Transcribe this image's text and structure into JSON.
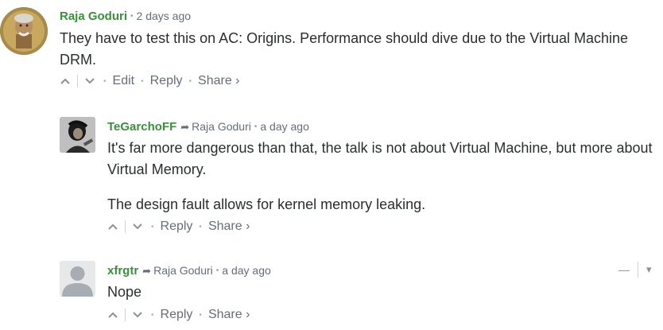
{
  "comments": [
    {
      "author": "Raja Goduri",
      "timestamp": "2 days ago",
      "message": [
        "They have to test this on AC: Origins. Performance should dive due to the Virtual Machine DRM."
      ],
      "actions": {
        "edit": "Edit",
        "reply": "Reply",
        "share": "Share ›"
      }
    },
    {
      "author": "TeGarchoFF",
      "reply_to": "Raja Goduri",
      "timestamp": "a day ago",
      "message": [
        "It's far more dangerous than that, the talk is not about Virtual Machine, but more about Virtual Memory.",
        "The design fault allows for kernel memory leaking."
      ],
      "actions": {
        "reply": "Reply",
        "share": "Share ›"
      }
    },
    {
      "author": "xfrgtr",
      "reply_to": "Raja Goduri",
      "timestamp": "a day ago",
      "message": [
        "Nope"
      ],
      "actions": {
        "reply": "Reply",
        "share": "Share ›"
      },
      "menu": {
        "collapse": "—",
        "more": "▾"
      }
    }
  ],
  "icons": {
    "upvote": "chevron-up-icon",
    "downvote": "chevron-down-icon",
    "reply_arrow": "reply-arrow-icon"
  },
  "colors": {
    "author": "#3a8f3a",
    "meta": "#656c7a",
    "text": "#2a2e2e"
  }
}
